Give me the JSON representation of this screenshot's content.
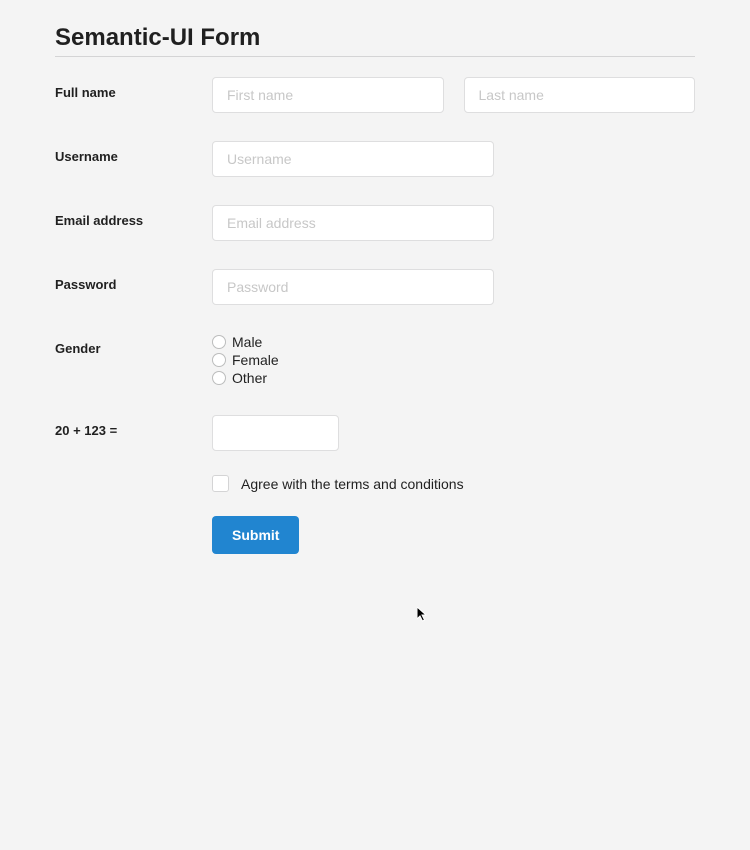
{
  "header": {
    "title": "Semantic-UI Form"
  },
  "fields": {
    "fullname": {
      "label": "Full name",
      "first_placeholder": "First name",
      "last_placeholder": "Last name"
    },
    "username": {
      "label": "Username",
      "placeholder": "Username"
    },
    "email": {
      "label": "Email address",
      "placeholder": "Email address"
    },
    "password": {
      "label": "Password",
      "placeholder": "Password"
    },
    "gender": {
      "label": "Gender",
      "options": {
        "male": "Male",
        "female": "Female",
        "other": "Other"
      }
    },
    "captcha": {
      "label": "20 + 123 ="
    },
    "terms": {
      "label": "Agree with the terms and conditions"
    },
    "submit": {
      "label": "Submit"
    }
  }
}
